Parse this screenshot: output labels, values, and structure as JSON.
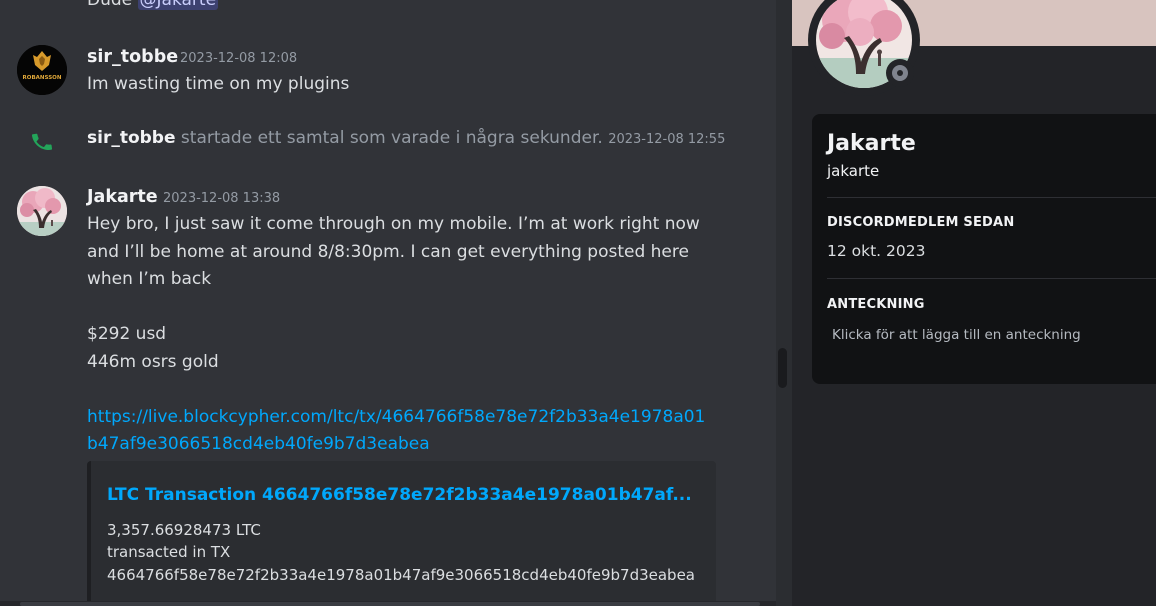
{
  "chat": {
    "prev_message": {
      "text": "Dude",
      "mention": "@Jakarte"
    },
    "msg1": {
      "author": "sir_tobbe",
      "timestamp": "2023-12-08 12:08",
      "text": "Im wasting time on my plugins",
      "avatar_text": "ROBANSSON"
    },
    "call": {
      "author": "sir_tobbe",
      "text": "startade ett samtal som varade i några sekunder.",
      "timestamp": "2023-12-08 12:55",
      "icon": "phone-icon"
    },
    "msg2": {
      "author": "Jakarte",
      "timestamp": "2023-12-08 13:38",
      "lines": [
        "Hey bro, I just saw it come through on my mobile. I’m at work right now",
        "and I’ll be home at around 8/8:30pm. I can get everything posted here",
        "when I’m back"
      ],
      "amount_usd": "$292 usd",
      "amount_gold": "446m osrs gold",
      "link_lines": [
        "https://live.blockcypher.com/ltc/tx/4664766f58e78e72f2b33a4e1978a01",
        "b47af9e3066518cd4eb40fe9b7d3eabea"
      ],
      "embed": {
        "title": "LTC Transaction 4664766f58e78e72f2b33a4e1978a01b47af...",
        "lines": [
          "3,357.66928473 LTC",
          "transacted in TX",
          "4664766f58e78e72f2b33a4e1978a01b47af9e3066518cd4eb40fe9b7d3eabea"
        ]
      }
    }
  },
  "profile": {
    "display_name": "Jakarte",
    "username": "jakarte",
    "member_since_heading": "DISCORDMEDLEM SEDAN",
    "member_since": "12 okt. 2023",
    "note_heading": "ANTECKNING",
    "note_placeholder": "Klicka för att lägga till en anteckning",
    "status": "offline"
  },
  "colors": {
    "link": "#00a8fc",
    "mention_bg": "#5865f2",
    "call_icon": "#23a55a",
    "status_offline": "#80848e"
  }
}
